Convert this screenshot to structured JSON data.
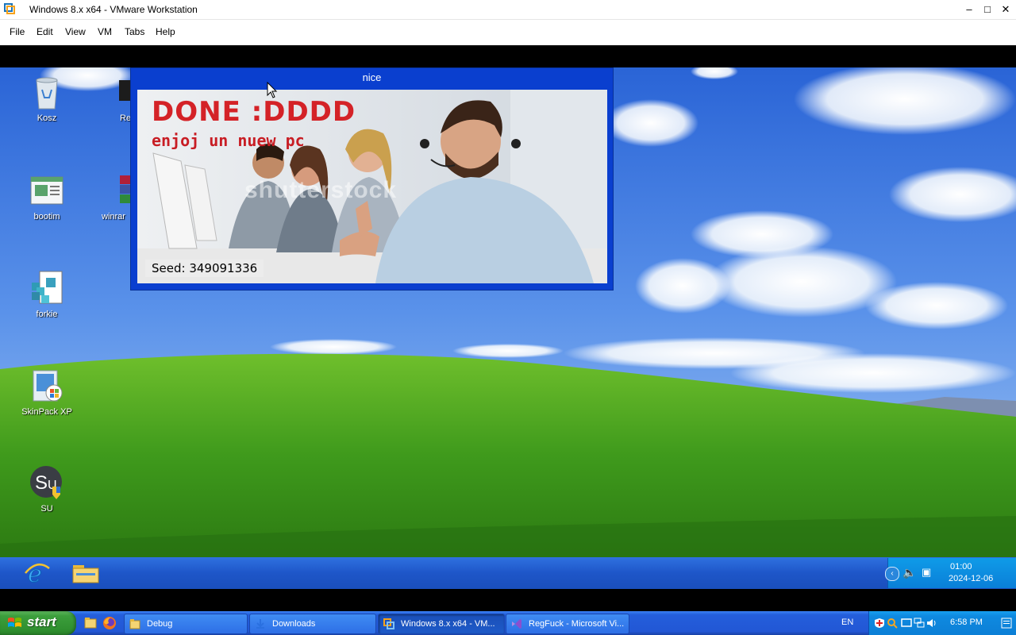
{
  "host": {
    "title": "Windows 8.x x64 - VMware Workstation",
    "menu": [
      "File",
      "Edit",
      "View",
      "VM",
      "Tabs",
      "Help"
    ],
    "window_buttons": {
      "minimize": "–",
      "maximize": "□",
      "close": "✕"
    }
  },
  "desktop": {
    "icons": [
      {
        "label": "Kosz",
        "icon": "recycle-bin-icon"
      },
      {
        "label": "Re",
        "icon": "app-icon"
      },
      {
        "label": "bootim",
        "icon": "window-icon"
      },
      {
        "label": "winrar",
        "icon": "winrar-icon"
      },
      {
        "label": "forkie",
        "icon": "registry-icon"
      },
      {
        "label": "SkinPack XP",
        "icon": "skinpack-icon"
      },
      {
        "label": "SU",
        "icon": "su-icon"
      }
    ]
  },
  "nice_window": {
    "title": "nice",
    "headline": "DONE :DDDD",
    "subline": "enjoj un nuew pc",
    "seed": "Seed: 349091336",
    "watermark": "shutterstock"
  },
  "guest_taskbar": {
    "time": "01:00",
    "date": "2024-12-06"
  },
  "host_taskbar": {
    "start_label": "start",
    "buttons": [
      {
        "label": "Debug",
        "icon": "folder-icon",
        "active": false
      },
      {
        "label": "Downloads",
        "icon": "download-icon",
        "active": false
      },
      {
        "label": "Windows 8.x x64 - VM...",
        "icon": "vmware-icon",
        "active": true
      },
      {
        "label": "RegFuck - Microsoft Vi...",
        "icon": "visual-studio-icon",
        "active": false
      }
    ],
    "language": "EN",
    "clock": "6:58 PM"
  },
  "colors": {
    "xp_blue": "#245edb",
    "start_green": "#3c9e3c",
    "nice_frame": "#0a3fcf",
    "headline_red": "#d42227"
  }
}
